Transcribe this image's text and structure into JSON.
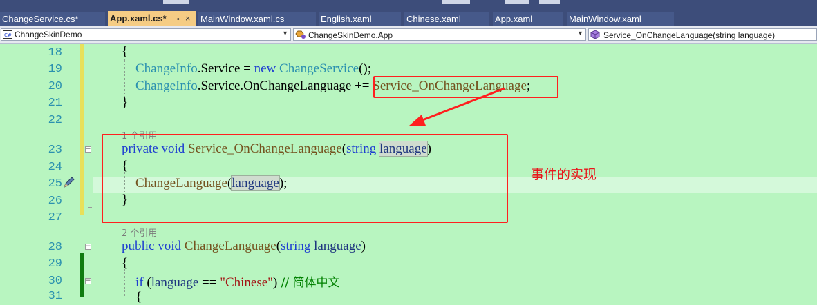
{
  "tabs": [
    {
      "label": "ChangeService.cs*",
      "active": false
    },
    {
      "label": "App.xaml.cs*",
      "active": true,
      "pin": "⊸",
      "close": "×"
    },
    {
      "label": "MainWindow.xaml.cs",
      "active": false
    },
    {
      "label": "English.xaml",
      "active": false
    },
    {
      "label": "Chinese.xaml",
      "active": false
    },
    {
      "label": "App.xaml",
      "active": false
    },
    {
      "label": "MainWindow.xaml",
      "active": false
    }
  ],
  "navbar": {
    "project": "ChangeSkinDemo",
    "type": "ChangeSkinDemo.App",
    "member": "Service_OnChangeLanguage(string language)"
  },
  "lines": {
    "n18": "18",
    "n19": "19",
    "n20": "20",
    "n21": "21",
    "n22": "22",
    "n23": "23",
    "n24": "24",
    "n25": "25",
    "n26": "26",
    "n27": "27",
    "n28": "28",
    "n29": "29",
    "n30": "30",
    "n31": "31"
  },
  "code": {
    "open_brace": "{",
    "close_brace": "}",
    "changeinfo": "ChangeInfo",
    "service_assign": ".Service = ",
    "kw_new": "new",
    "changeservice": "ChangeService",
    "ctor_tail": "();",
    "service_event": ".Service.OnChangeLanguage += ",
    "handler": "Service_OnChangeLanguage",
    "semicolon": ";",
    "refs1": "1 个引用",
    "refs2": "2 个引用",
    "kw_private": "private",
    "kw_public": "public",
    "kw_void": "void",
    "kw_string": "string",
    "kw_if": "if",
    "param_language": "language",
    "open_paren": "(",
    "close_paren": ")",
    "method_change": "ChangeLanguage",
    "call_tail": ");",
    "eq": " == ",
    "str_chinese": "\"Chinese\"",
    "comment": " // 简体中文"
  },
  "annotation": "事件的实现",
  "colors": {
    "annotation_red": "#ff1f1f",
    "editor_background": "#b8f5c0",
    "keyword_blue": "#1f3fd0",
    "type_teal": "#2b91af",
    "method_brown": "#74531f",
    "string_red": "#a31515",
    "comment_green": "#008000"
  },
  "icons": {
    "project_icon": "csharp-project-icon",
    "type_icon": "class-icon",
    "member_icon": "method-icon",
    "gutter_icon": "quick-action-pencil-icon"
  }
}
